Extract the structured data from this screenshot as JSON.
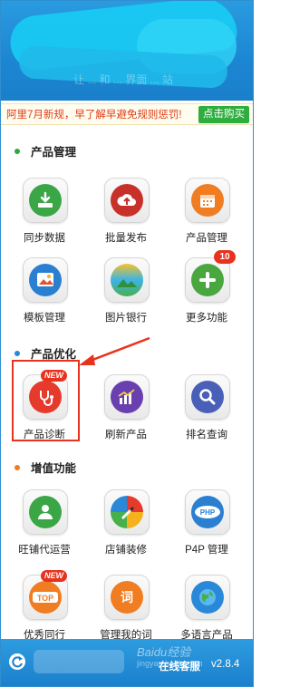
{
  "notice": {
    "text": "阿里7月新规，早了解早避免规则惩罚!",
    "button": "点击购买"
  },
  "sections": {
    "product_management": {
      "title": "产品管理",
      "dot_color": "#2fa83c"
    },
    "product_optimization": {
      "title": "产品优化",
      "dot_color": "#2a88d8"
    },
    "value_added": {
      "title": "增值功能",
      "dot_color": "#f07b1e"
    }
  },
  "tiles": {
    "sync_data": {
      "label": "同步数据",
      "icon": "download-icon",
      "color": "#3aa645"
    },
    "bulk_publish": {
      "label": "批量发布",
      "icon": "cloud-upload-icon",
      "color": "#c8302a"
    },
    "product_mgmt": {
      "label": "产品管理",
      "icon": "calendar-icon",
      "color": "#f07d22"
    },
    "template_mgmt": {
      "label": "模板管理",
      "icon": "picture-icon",
      "color": "#2a7fd0"
    },
    "image_bank": {
      "label": "图片银行",
      "icon": "landscape-icon",
      "color": "#48b04a"
    },
    "more_features": {
      "label": "更多功能",
      "icon": "plus-icon",
      "color": "#4aa63f",
      "badge": "10"
    },
    "product_diagnosis": {
      "label": "产品诊断",
      "icon": "stethoscope-icon",
      "color": "#e53a2c",
      "badge": "NEW"
    },
    "refresh_products": {
      "label": "刷新产品",
      "icon": "bar-chart-icon",
      "color": "#6a3fb0"
    },
    "ranking_query": {
      "label": "排名查询",
      "icon": "magnifier-icon",
      "color": "#4a5fb8"
    },
    "shop_operation": {
      "label": "旺铺代运营",
      "icon": "person-icon",
      "color": "#3aa645"
    },
    "shop_decoration": {
      "label": "店铺装修",
      "icon": "paintbrush-icon",
      "color": "#444444"
    },
    "p4p_management": {
      "label": "P4P 管理",
      "icon": "php-icon",
      "color": "#2a7fd0"
    },
    "top_peers": {
      "label": "优秀同行",
      "icon": "top-icon",
      "color": "#f07d22",
      "badge": "NEW"
    },
    "my_words": {
      "label": "管理我的词",
      "icon": "word-icon",
      "color": "#f07d22"
    },
    "multilingual": {
      "label": "多语言产品",
      "icon": "globe-icon",
      "color": "#2a88d8"
    }
  },
  "footer": {
    "online": "在线客服",
    "version": "v2.8.4",
    "watermark": "Baidu经验",
    "watermark_url": "jingyan.baidu.com"
  },
  "header": {
    "faint_text": "让 ... 和 ... 界面 ... 站"
  }
}
